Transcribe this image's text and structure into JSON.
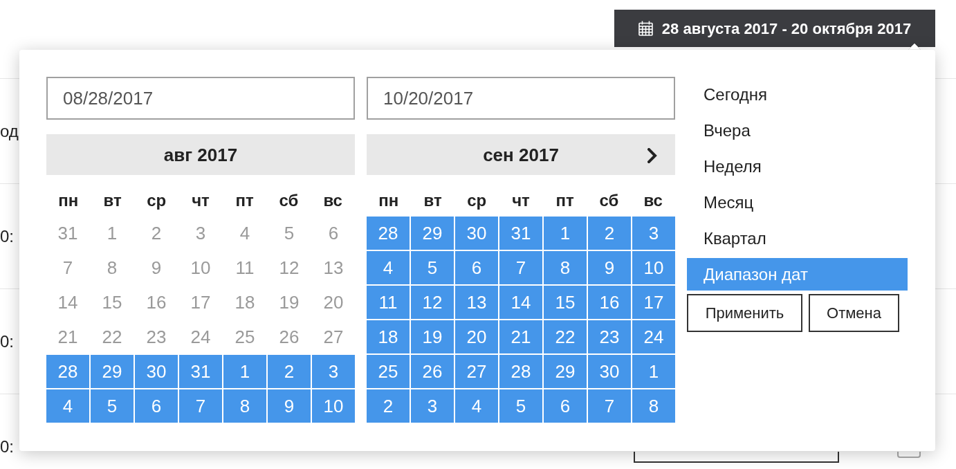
{
  "date_range_button": {
    "label": "28 августа 2017 - 20 октября 2017"
  },
  "background_rows": [
    {
      "text": "од"
    },
    {
      "text": "0:"
    },
    {
      "text": "0:"
    },
    {
      "text": "0:"
    }
  ],
  "calendars": [
    {
      "date_field": {
        "value": "08/28/2017"
      },
      "title": "авг 2017",
      "next": false,
      "weekdays": [
        "пн",
        "вт",
        "ср",
        "чт",
        "пт",
        "сб",
        "вс"
      ],
      "days": [
        {
          "label": "31",
          "in_range": false
        },
        {
          "label": "1",
          "in_range": false
        },
        {
          "label": "2",
          "in_range": false
        },
        {
          "label": "3",
          "in_range": false
        },
        {
          "label": "4",
          "in_range": false
        },
        {
          "label": "5",
          "in_range": false
        },
        {
          "label": "6",
          "in_range": false
        },
        {
          "label": "7",
          "in_range": false
        },
        {
          "label": "8",
          "in_range": false
        },
        {
          "label": "9",
          "in_range": false
        },
        {
          "label": "10",
          "in_range": false
        },
        {
          "label": "11",
          "in_range": false
        },
        {
          "label": "12",
          "in_range": false
        },
        {
          "label": "13",
          "in_range": false
        },
        {
          "label": "14",
          "in_range": false
        },
        {
          "label": "15",
          "in_range": false
        },
        {
          "label": "16",
          "in_range": false
        },
        {
          "label": "17",
          "in_range": false
        },
        {
          "label": "18",
          "in_range": false
        },
        {
          "label": "19",
          "in_range": false
        },
        {
          "label": "20",
          "in_range": false
        },
        {
          "label": "21",
          "in_range": false
        },
        {
          "label": "22",
          "in_range": false
        },
        {
          "label": "23",
          "in_range": false
        },
        {
          "label": "24",
          "in_range": false
        },
        {
          "label": "25",
          "in_range": false
        },
        {
          "label": "26",
          "in_range": false
        },
        {
          "label": "27",
          "in_range": false
        },
        {
          "label": "28",
          "in_range": true
        },
        {
          "label": "29",
          "in_range": true
        },
        {
          "label": "30",
          "in_range": true
        },
        {
          "label": "31",
          "in_range": true
        },
        {
          "label": "1",
          "in_range": true
        },
        {
          "label": "2",
          "in_range": true
        },
        {
          "label": "3",
          "in_range": true
        },
        {
          "label": "4",
          "in_range": true
        },
        {
          "label": "5",
          "in_range": true
        },
        {
          "label": "6",
          "in_range": true
        },
        {
          "label": "7",
          "in_range": true
        },
        {
          "label": "8",
          "in_range": true
        },
        {
          "label": "9",
          "in_range": true
        },
        {
          "label": "10",
          "in_range": true
        }
      ]
    },
    {
      "date_field": {
        "value": "10/20/2017"
      },
      "title": "сен 2017",
      "next": true,
      "weekdays": [
        "пн",
        "вт",
        "ср",
        "чт",
        "пт",
        "сб",
        "вс"
      ],
      "days": [
        {
          "label": "28",
          "in_range": true
        },
        {
          "label": "29",
          "in_range": true
        },
        {
          "label": "30",
          "in_range": true
        },
        {
          "label": "31",
          "in_range": true
        },
        {
          "label": "1",
          "in_range": true
        },
        {
          "label": "2",
          "in_range": true
        },
        {
          "label": "3",
          "in_range": true
        },
        {
          "label": "4",
          "in_range": true
        },
        {
          "label": "5",
          "in_range": true
        },
        {
          "label": "6",
          "in_range": true
        },
        {
          "label": "7",
          "in_range": true
        },
        {
          "label": "8",
          "in_range": true
        },
        {
          "label": "9",
          "in_range": true
        },
        {
          "label": "10",
          "in_range": true
        },
        {
          "label": "11",
          "in_range": true
        },
        {
          "label": "12",
          "in_range": true
        },
        {
          "label": "13",
          "in_range": true
        },
        {
          "label": "14",
          "in_range": true
        },
        {
          "label": "15",
          "in_range": true
        },
        {
          "label": "16",
          "in_range": true
        },
        {
          "label": "17",
          "in_range": true
        },
        {
          "label": "18",
          "in_range": true
        },
        {
          "label": "19",
          "in_range": true
        },
        {
          "label": "20",
          "in_range": true
        },
        {
          "label": "21",
          "in_range": true
        },
        {
          "label": "22",
          "in_range": true
        },
        {
          "label": "23",
          "in_range": true
        },
        {
          "label": "24",
          "in_range": true
        },
        {
          "label": "25",
          "in_range": true
        },
        {
          "label": "26",
          "in_range": true
        },
        {
          "label": "27",
          "in_range": true
        },
        {
          "label": "28",
          "in_range": true
        },
        {
          "label": "29",
          "in_range": true
        },
        {
          "label": "30",
          "in_range": true
        },
        {
          "label": "1",
          "in_range": true
        },
        {
          "label": "2",
          "in_range": true
        },
        {
          "label": "3",
          "in_range": true
        },
        {
          "label": "4",
          "in_range": true
        },
        {
          "label": "5",
          "in_range": true
        },
        {
          "label": "6",
          "in_range": true
        },
        {
          "label": "7",
          "in_range": true
        },
        {
          "label": "8",
          "in_range": true
        }
      ]
    }
  ],
  "ranges": [
    {
      "label": "Сегодня",
      "selected": false
    },
    {
      "label": "Вчера",
      "selected": false
    },
    {
      "label": "Неделя",
      "selected": false
    },
    {
      "label": "Месяц",
      "selected": false
    },
    {
      "label": "Квартал",
      "selected": false
    },
    {
      "label": "Диапазон дат",
      "selected": true
    }
  ],
  "buttons": [
    {
      "kind": "apply",
      "label": "Применить"
    },
    {
      "kind": "cancel",
      "label": "Отмена"
    }
  ]
}
